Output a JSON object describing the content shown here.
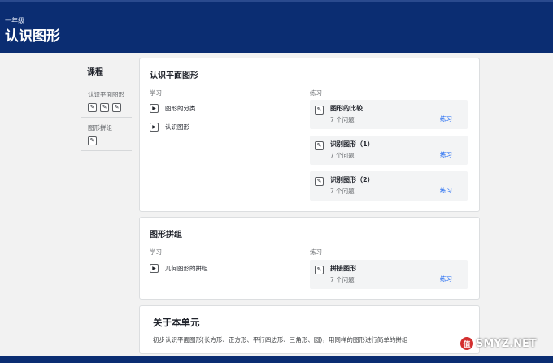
{
  "header": {
    "grade": "一年级",
    "unit_title": "认识图形"
  },
  "sidebar": {
    "course_link": "课程",
    "groups": [
      {
        "label": "认识平面图形",
        "icon_count": 3
      },
      {
        "label": "图形拼组",
        "icon_count": 1
      }
    ]
  },
  "lessons": [
    {
      "title": "认识平面图形",
      "learn_label": "学习",
      "practice_label": "练习",
      "learn_items": [
        {
          "text": "图形的分类",
          "icon": "play-icon"
        },
        {
          "text": "认识图形",
          "icon": "play-icon"
        }
      ],
      "practices": [
        {
          "name": "图形的比较",
          "count": "7 个问题",
          "action": "练习",
          "icon": "pencil-icon"
        },
        {
          "name": "识别图形（1）",
          "count": "7 个问题",
          "action": "练习",
          "icon": "pencil-icon"
        },
        {
          "name": "识别图形（2）",
          "count": "7 个问题",
          "action": "练习",
          "icon": "pencil-icon"
        }
      ]
    },
    {
      "title": "图形拼组",
      "learn_label": "学习",
      "practice_label": "练习",
      "learn_items": [
        {
          "text": "几何图形的拼组",
          "icon": "play-icon"
        }
      ],
      "practices": [
        {
          "name": "拼接图形",
          "count": "7 个问题",
          "action": "练习",
          "icon": "pencil-icon"
        }
      ]
    }
  ],
  "about": {
    "title": "关于本单元",
    "description": "初步认识平面图形(长方形、正方形、平行四边形、三角形、圆)，用同样的图形进行简单的拼组"
  },
  "watermark": {
    "badge": "值",
    "text": "SMYZ.NET"
  },
  "colors": {
    "header_bg": "#0b2d72",
    "link_blue": "#1865f2",
    "page_bg": "#f2f2f2"
  }
}
